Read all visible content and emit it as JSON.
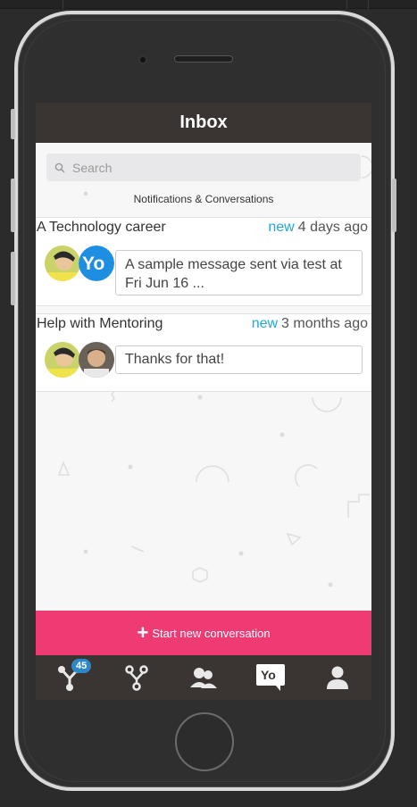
{
  "header": {
    "title": "Inbox"
  },
  "search": {
    "placeholder": "Search"
  },
  "subtitle": "Notifications & Conversations",
  "conversations": [
    {
      "title": "A Technology career",
      "new_label": "new",
      "time": "4 days ago",
      "message_line1": "A sample message sent via test at",
      "message_line2": "Fri Jun 16 ...",
      "second_avatar": "Yo"
    },
    {
      "title": "Help with Mentoring",
      "new_label": "new",
      "time": "3 months ago",
      "message_line1": "Thanks for that!"
    }
  ],
  "cta": {
    "label": "Start new conversation"
  },
  "tabbar": {
    "badge": "45",
    "active_tab": "yo-chat",
    "yo_logo": "Yo"
  },
  "colors": {
    "header": "#3a3533",
    "cta": "#ee3b73",
    "accent": "#22a7d6",
    "badge": "#2e88c8"
  }
}
